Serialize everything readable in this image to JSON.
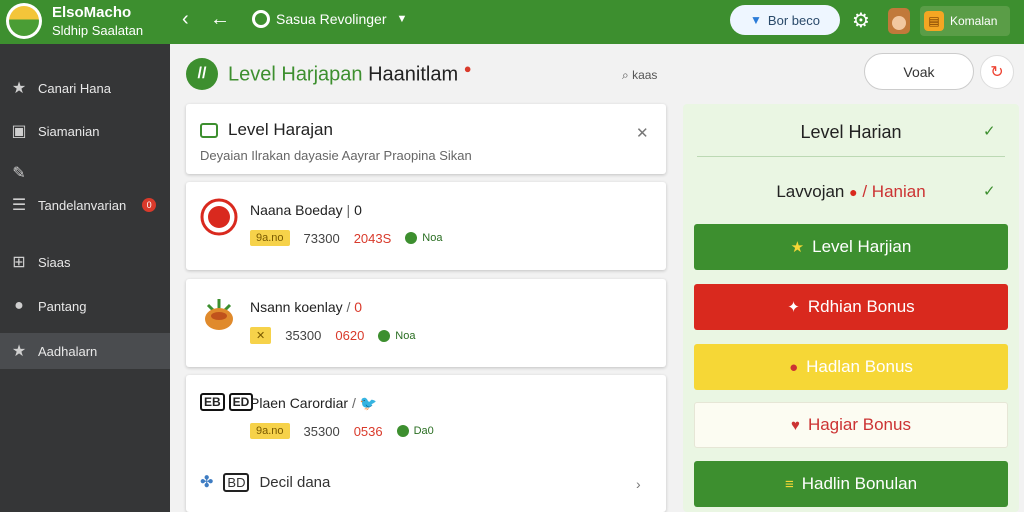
{
  "brand": {
    "title": "ElsoMacho",
    "subtitle": "Sldhip Saalatan"
  },
  "topbar": {
    "status_label": "Sasua Revolinger",
    "status_btn_label": "Bor beco",
    "user_label": "Komalan"
  },
  "sidebar": {
    "items": [
      {
        "label": "Canari Hana",
        "icon": "star-icon"
      },
      {
        "label": "Siamanian",
        "icon": "document-icon"
      },
      {
        "label": "",
        "icon": "tools-icon"
      },
      {
        "label": "Tandelanvarian",
        "icon": "list-icon",
        "badge": "0",
        "sub": "Siaas"
      },
      {
        "label": "Siaas",
        "icon": "grid-icon"
      },
      {
        "label": "Pantang",
        "icon": "location-icon"
      },
      {
        "label": "Aadhalarn",
        "icon": "star-icon",
        "active": true
      }
    ]
  },
  "main": {
    "title_green": "Level Harjapan",
    "title_dark": "Haanitlam",
    "search_label": "kaas",
    "right_button": "Voak",
    "card": {
      "title": "Level Harajan",
      "description": "Deyaian Ilrakan dayasie Aayrar Praopina Sikan"
    },
    "items": [
      {
        "name": "Naana Boeday",
        "suffix": "0",
        "tag": "9a.no",
        "points": "73300",
        "value": "2043S",
        "status": "Noa"
      },
      {
        "name": "Nsann koenlay",
        "suffix": "0",
        "tag": "",
        "points": "35300",
        "value": "0620",
        "status": "Noa"
      },
      {
        "name": "Plaen Carordiar",
        "suffix": "",
        "tag": "9a.no",
        "points": "35300",
        "value": "0536",
        "status": "Da0"
      }
    ],
    "last_row": {
      "label": "Decil dana",
      "code": "BD"
    }
  },
  "panel": {
    "title": "Level Harian",
    "sub_left": "Lavvojan",
    "sub_sep": "/",
    "sub_right": "Hanian",
    "buttons": [
      {
        "label": "Level Harjian",
        "icon": "star-icon"
      },
      {
        "label": "Rdhian Bonus",
        "icon": "sparkle-icon"
      },
      {
        "label": "Hadlan Bonus",
        "icon": "circle-icon"
      },
      {
        "label": "Hagiar Bonus",
        "icon": "heart-icon"
      },
      {
        "label": "Hadlin Bonulan",
        "icon": "coins-icon"
      }
    ]
  },
  "colors": {
    "primary": "#3d8f2f",
    "danger": "#d9291e",
    "warning": "#f6d736",
    "sidebar": "#353637"
  }
}
